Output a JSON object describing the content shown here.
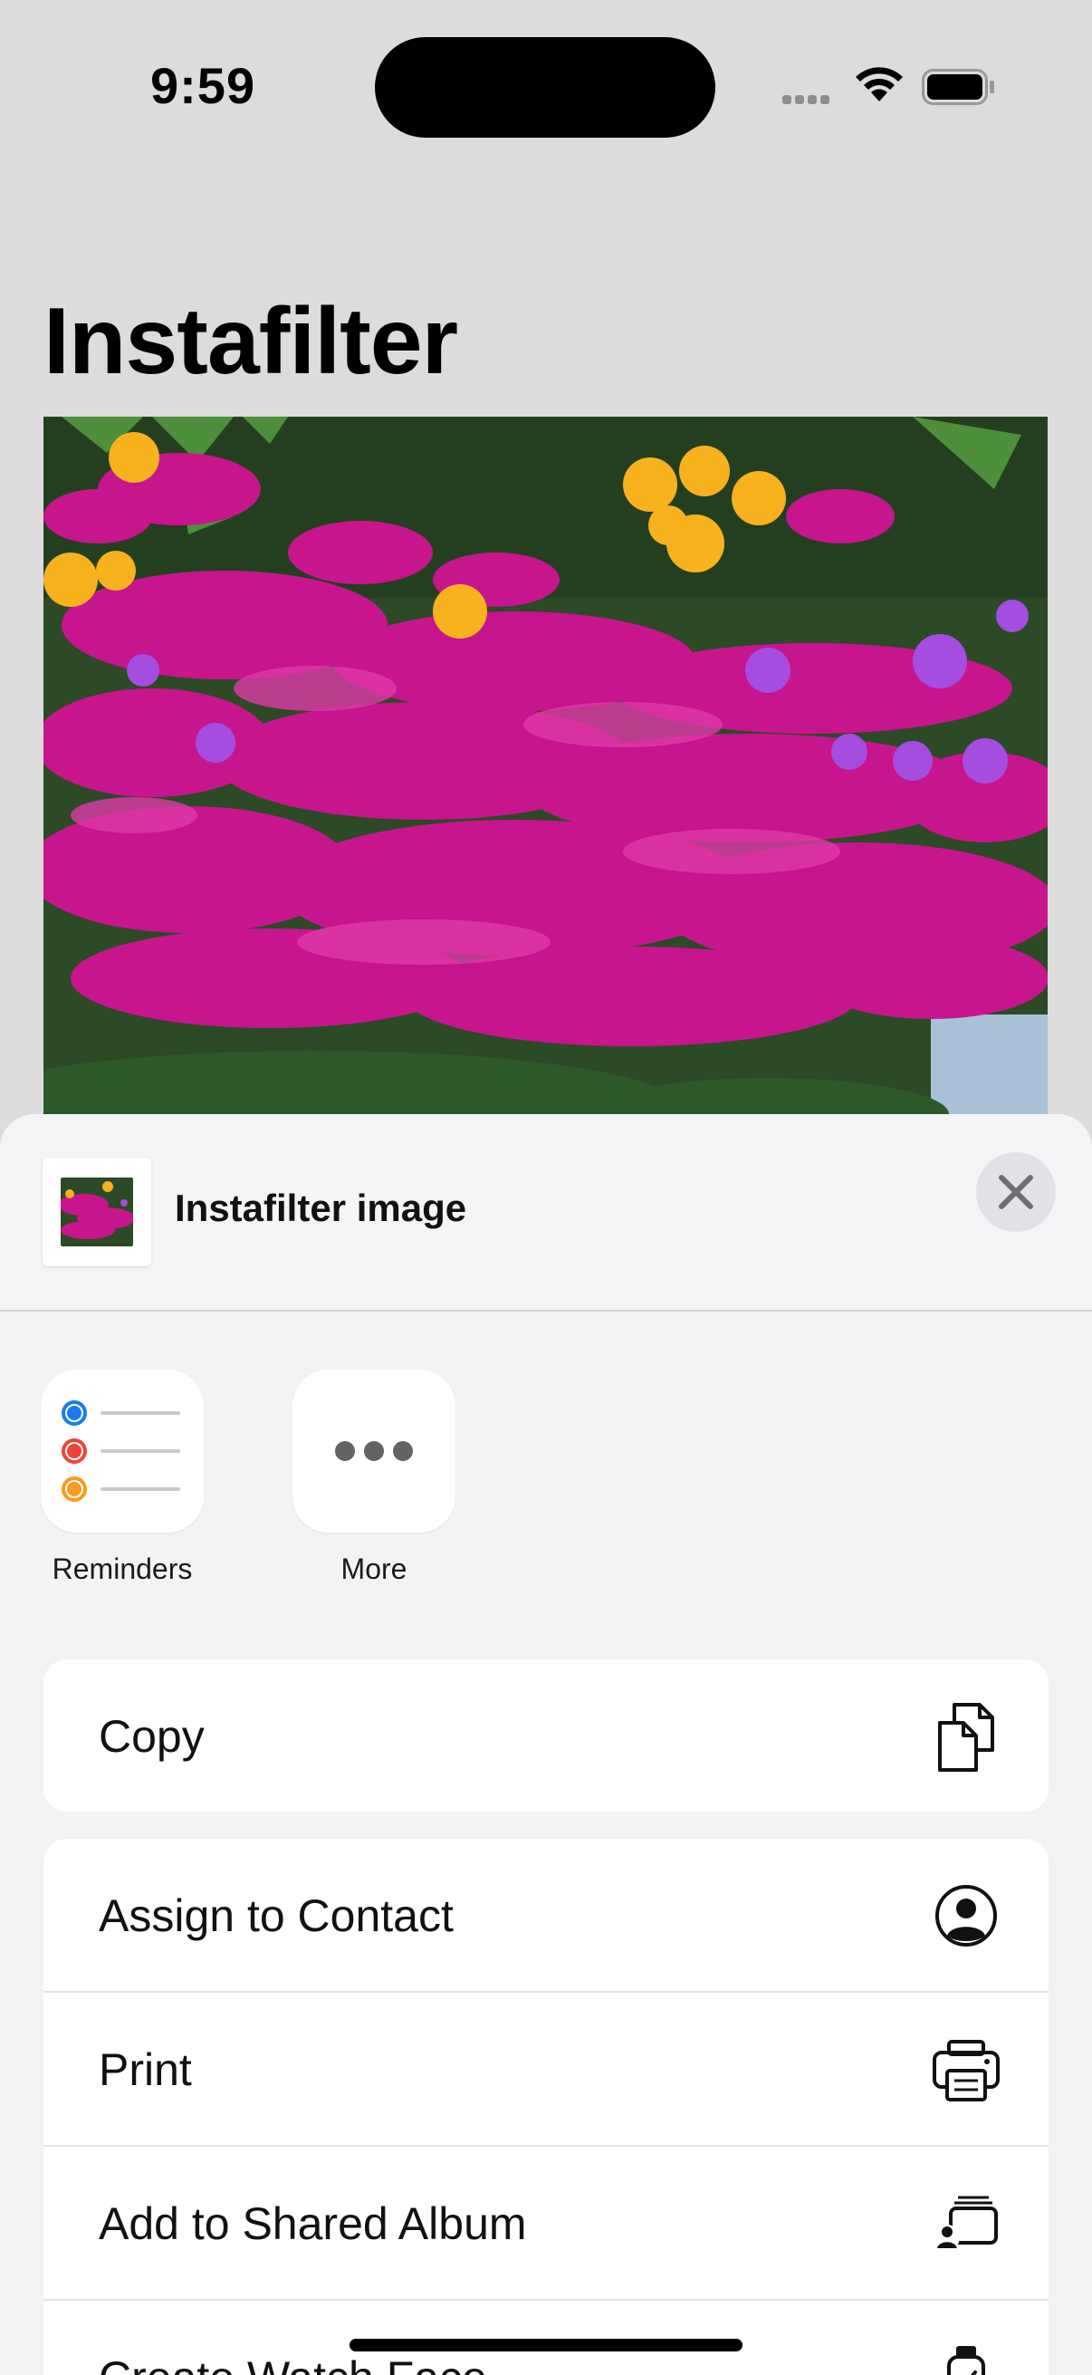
{
  "status_bar": {
    "time": "9:59"
  },
  "page": {
    "title": "Instafilter"
  },
  "share_sheet": {
    "title": "Instafilter image",
    "apps": [
      {
        "label": "Reminders",
        "icon": "reminders-icon"
      },
      {
        "label": "More",
        "icon": "more-icon"
      }
    ],
    "actions_group1": [
      {
        "label": "Copy",
        "icon": "copy-icon"
      }
    ],
    "actions_group2": [
      {
        "label": "Assign to Contact",
        "icon": "contact-icon"
      },
      {
        "label": "Print",
        "icon": "printer-icon"
      },
      {
        "label": "Add to Shared Album",
        "icon": "shared-album-icon"
      },
      {
        "label": "Create Watch Face",
        "icon": "watch-icon"
      }
    ]
  },
  "colors": {
    "background": "#dcdcdc",
    "sheet": "#f2f3f5",
    "reminder_blue": "#1a7cf5",
    "reminder_red": "#f0443a",
    "reminder_orange": "#fb9b1d",
    "flower_magenta": "#c7158e",
    "flower_yellow": "#f7b21e"
  }
}
